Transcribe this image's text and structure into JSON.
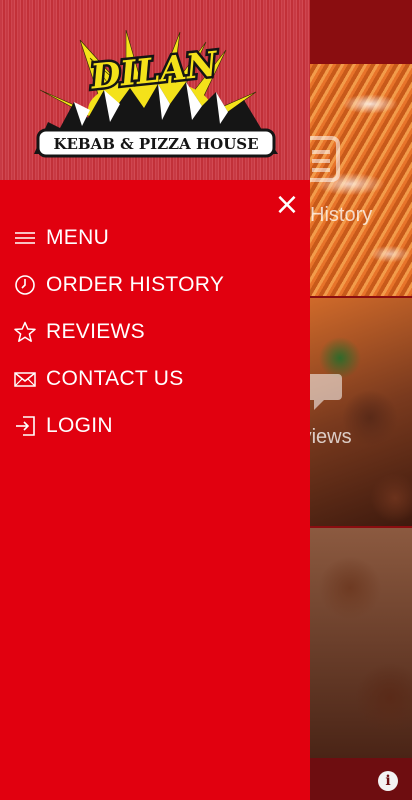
{
  "logo": {
    "title": "DILAN",
    "subtitle": "KEBAB & PIZZA HOUSE"
  },
  "drawer": {
    "close_icon": "×",
    "items": [
      {
        "label": "MENU",
        "icon": "hamburger-icon"
      },
      {
        "label": "ORDER HISTORY",
        "icon": "clock-icon"
      },
      {
        "label": "REVIEWS",
        "icon": "star-icon"
      },
      {
        "label": "CONTACT US",
        "icon": "envelope-icon"
      },
      {
        "label": "LOGIN",
        "icon": "login-icon"
      }
    ]
  },
  "background": {
    "tiles": [
      {
        "label": "History",
        "icon": "list-icon"
      },
      {
        "label": "Reviews",
        "icon": "chat-bubble-icon"
      }
    ],
    "info_icon": "i"
  },
  "colors": {
    "drawer": "#e1000f",
    "header": "#cf4650",
    "text": "#ffffff"
  }
}
